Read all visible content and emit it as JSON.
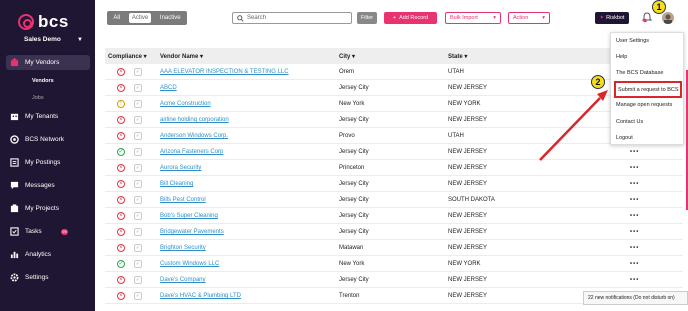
{
  "brand": {
    "logo_text": "bcs",
    "org": "Sales Demo"
  },
  "sidebar": {
    "items": [
      {
        "label": "My Vendors",
        "icon": "vendors-icon"
      },
      {
        "label": "My Tenants",
        "icon": "tenants-icon"
      },
      {
        "label": "BCS Network",
        "icon": "network-icon"
      },
      {
        "label": "My Postings",
        "icon": "postings-icon"
      },
      {
        "label": "Messages",
        "icon": "messages-icon"
      },
      {
        "label": "My Projects",
        "icon": "projects-icon"
      },
      {
        "label": "Tasks",
        "icon": "tasks-icon",
        "badge": "99"
      },
      {
        "label": "Analytics",
        "icon": "analytics-icon"
      },
      {
        "label": "Settings",
        "icon": "settings-icon"
      }
    ],
    "sub_items": [
      "Vendors",
      "Jobs"
    ]
  },
  "toolbar": {
    "seg": [
      "All",
      "Active",
      "Inactive"
    ],
    "search_placeholder": "Search",
    "filter": "Filter",
    "add_record": "Add Record",
    "bulk_import": "Bulk Import",
    "action": "Action",
    "riskbot": "Riskbot"
  },
  "callouts": {
    "one": "1",
    "two": "2"
  },
  "table": {
    "headers": {
      "compliance": "Compliance",
      "vendor": "Vendor Name",
      "city": "City",
      "state": "State"
    },
    "rows": [
      {
        "status": "red",
        "vendor": "AAA ELEVATOR INSPECTION & TESTING LLC",
        "city": "Orem",
        "state": "UTAH"
      },
      {
        "status": "red",
        "vendor": "ABCD",
        "city": "Jersey City",
        "state": "NEW JERSEY"
      },
      {
        "status": "yellow",
        "vendor": "Acme Construction",
        "city": "New York",
        "state": "NEW YORK"
      },
      {
        "status": "red",
        "vendor": "airline holding corporation",
        "city": "Jersey City",
        "state": "NEW JERSEY"
      },
      {
        "status": "red",
        "vendor": "Anderson Windows Corp.",
        "city": "Provo",
        "state": "UTAH"
      },
      {
        "status": "green",
        "vendor": "Arizona Fasteners Corp",
        "city": "Jersey City",
        "state": "NEW JERSEY"
      },
      {
        "status": "red",
        "vendor": "Aurora Security",
        "city": "Princeton",
        "state": "NEW JERSEY"
      },
      {
        "status": "red",
        "vendor": "Bill Cleaning",
        "city": "Jersey City",
        "state": "NEW JERSEY"
      },
      {
        "status": "red",
        "vendor": "Bills Pest Control",
        "city": "Jersey City",
        "state": "SOUTH DAKOTA"
      },
      {
        "status": "red",
        "vendor": "Bob's Super Cleaning",
        "city": "Jersey City",
        "state": "NEW JERSEY"
      },
      {
        "status": "red",
        "vendor": "Bridgewater Pavements",
        "city": "Jersey City",
        "state": "NEW JERSEY"
      },
      {
        "status": "red",
        "vendor": "Brighton Security",
        "city": "Matawan",
        "state": "NEW JERSEY"
      },
      {
        "status": "green",
        "vendor": "Custom Windows LLC",
        "city": "New York",
        "state": "NEW YORK"
      },
      {
        "status": "red",
        "vendor": "Dave's Company",
        "city": "Jersey City",
        "state": "NEW JERSEY"
      },
      {
        "status": "red",
        "vendor": "Dave's HVAC & Plumbing LTD",
        "city": "Trenton",
        "state": "NEW JERSEY"
      }
    ]
  },
  "dropdown": {
    "items": [
      "User Settings",
      "Help",
      "The BCS Database",
      "Submit a request to BCS",
      "Manage open requests",
      "Contact Us",
      "Logout"
    ],
    "highlighted_index": 3
  },
  "toast": "22 new notifications (Do not disturb on)",
  "colors": {
    "sidebar_bg": "#1f1633",
    "accent": "#e8336e",
    "link": "#2f8fc9",
    "highlight": "#d8262b",
    "callout": "#f4df1a"
  }
}
